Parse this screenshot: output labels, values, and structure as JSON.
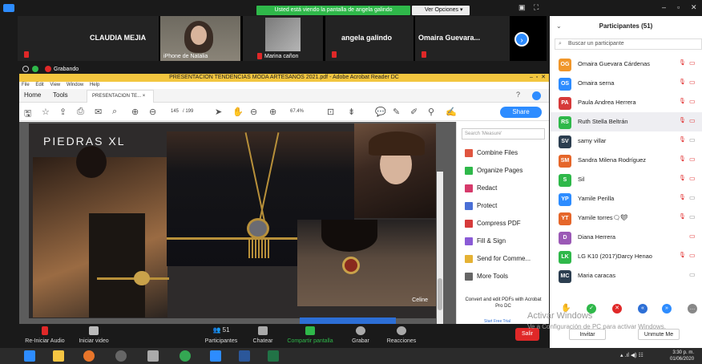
{
  "zoom": {
    "share_banner": "Usted está viendo la pantalla de angela galindo",
    "view_options": "Ver Opciones",
    "video_tiles": [
      {
        "name": "CLAUDIA MEJIA"
      },
      {
        "name": "iPhone de Natalia"
      },
      {
        "name": "Marina cañon"
      },
      {
        "name": "angela galindo"
      },
      {
        "name": "Omaira  Guevara..."
      }
    ],
    "recording_label": "Grabando",
    "toolbar": [
      {
        "label": "Re-Iniciar Audio"
      },
      {
        "label": "Iniciar video"
      },
      {
        "label": "Participantes",
        "count": "51"
      },
      {
        "label": "Chatear"
      },
      {
        "label": "Compartir pantalla"
      },
      {
        "label": "Grabar"
      },
      {
        "label": "Reacciones"
      }
    ],
    "leave_label": "Salir"
  },
  "acrobat": {
    "window_title": "PRESENTACION TENDENCIAS MODA ARTESANOS 2021.pdf - Adobe Acrobat Reader DC",
    "menu": [
      "File",
      "Edit",
      "View",
      "Window",
      "Help"
    ],
    "tabs": {
      "home": "Home",
      "tools": "Tools",
      "doc": "PRESENTACION TE..."
    },
    "page_current": "145",
    "page_total": "/ 199",
    "zoom_level": "67.4%",
    "share_label": "Share",
    "search_placeholder": "Search 'Measure'",
    "tools": [
      {
        "label": "Combine Files",
        "color": "#e0553f"
      },
      {
        "label": "Organize Pages",
        "color": "#2fb84a"
      },
      {
        "label": "Redact",
        "color": "#d63a6b"
      },
      {
        "label": "Protect",
        "color": "#4a6fd6"
      },
      {
        "label": "Compress PDF",
        "color": "#d63a3a"
      },
      {
        "label": "Fill & Sign",
        "color": "#8a5bd6"
      },
      {
        "label": "Send for Comme...",
        "color": "#e5b234"
      },
      {
        "label": "More Tools",
        "color": "#666666"
      }
    ],
    "convert_text": "Convert and edit PDFs with Acrobat Pro DC",
    "free_trial": "Start Free Trial",
    "slide": {
      "title": "PIEDRAS XL",
      "credit": "Celine"
    }
  },
  "participants": {
    "header": "Participantes (51)",
    "search_placeholder": "Buscar un participante",
    "list": [
      {
        "initials": "OG",
        "name": "Omaira Guevara Cárdenas",
        "color": "#f0962a"
      },
      {
        "initials": "OS",
        "name": "Omaira serna",
        "color": "#2d8cff"
      },
      {
        "initials": "PA",
        "name": "Paula Andrea Herrera",
        "color": "#d63a3a"
      },
      {
        "initials": "RS",
        "name": "Ruth Stella Beltrán",
        "color": "#2fb84a"
      },
      {
        "initials": "SV",
        "name": "samy villar",
        "color": "#2c3e50"
      },
      {
        "initials": "SM",
        "name": "Sandra Milena Rodríguez",
        "color": "#e5662a"
      },
      {
        "initials": "S",
        "name": "Sil",
        "color": "#2fb84a"
      },
      {
        "initials": "YP",
        "name": "Yamile Perilla",
        "color": "#2d8cff"
      },
      {
        "initials": "YT",
        "name": "Yamile torres🗨❤",
        "color": "#e5662a"
      },
      {
        "initials": "D",
        "name": "Diana Herrera",
        "color": "#9b59b6"
      },
      {
        "initials": "LK",
        "name": "LG K10 (2017)Darcy Henao",
        "color": "#2fb84a"
      },
      {
        "initials": "MC",
        "name": "Maria caracas",
        "color": "#2c3e50"
      }
    ],
    "invite": "Invitar",
    "unmute_me": "Unmute Me"
  },
  "windows": {
    "activate_title": "Activar Windows",
    "activate_sub": "Ve a Configuración de PC para activar Windows.",
    "time": "3:30 p. m.",
    "date": "01/06/2020"
  }
}
